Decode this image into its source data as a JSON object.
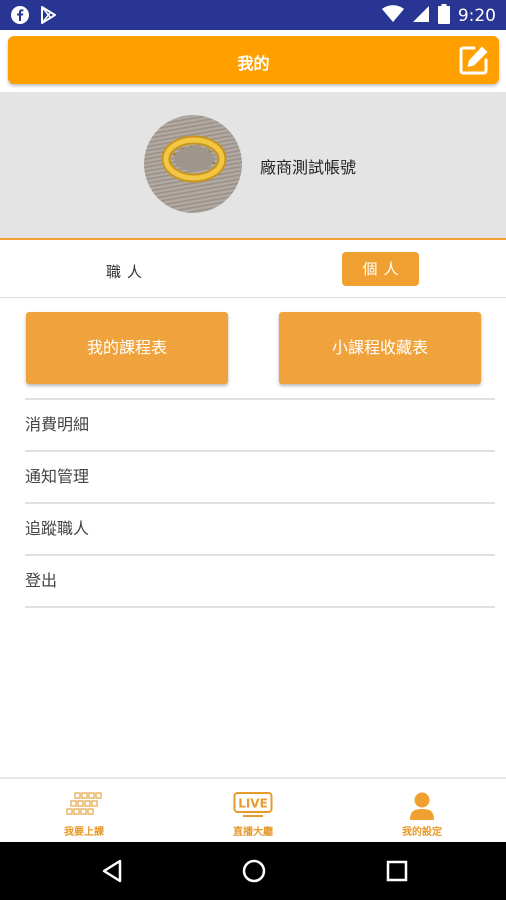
{
  "status_bar": {
    "time": "9:20",
    "left_icons": [
      "facebook-icon",
      "play-store-icon"
    ],
    "right_icons": [
      "wifi-icon",
      "signal-icon",
      "battery-icon"
    ]
  },
  "header": {
    "title": "我的",
    "edit_icon": "edit-icon",
    "color": "#ffa000"
  },
  "profile": {
    "username": "廠商測試帳號",
    "avatar": "ring-photo"
  },
  "toggle": {
    "left_label": "職人",
    "right_label": "個人",
    "selected": "個人"
  },
  "actions": {
    "schedule_label": "我的課程表",
    "favorites_label": "小課程收藏表",
    "color": "#f0a33c"
  },
  "menu": {
    "items": [
      {
        "label": "消費明細"
      },
      {
        "label": "通知管理"
      },
      {
        "label": "追蹤職人"
      },
      {
        "label": "登出"
      }
    ]
  },
  "bottom_nav": {
    "items": [
      {
        "label": "我要上課",
        "icon": "grid-icon"
      },
      {
        "label": "直播大廳",
        "icon": "live-icon"
      },
      {
        "label": "我的設定",
        "icon": "person-icon",
        "active": true
      }
    ]
  },
  "android_nav": {
    "buttons": [
      "back-icon",
      "home-icon",
      "recents-icon"
    ]
  }
}
